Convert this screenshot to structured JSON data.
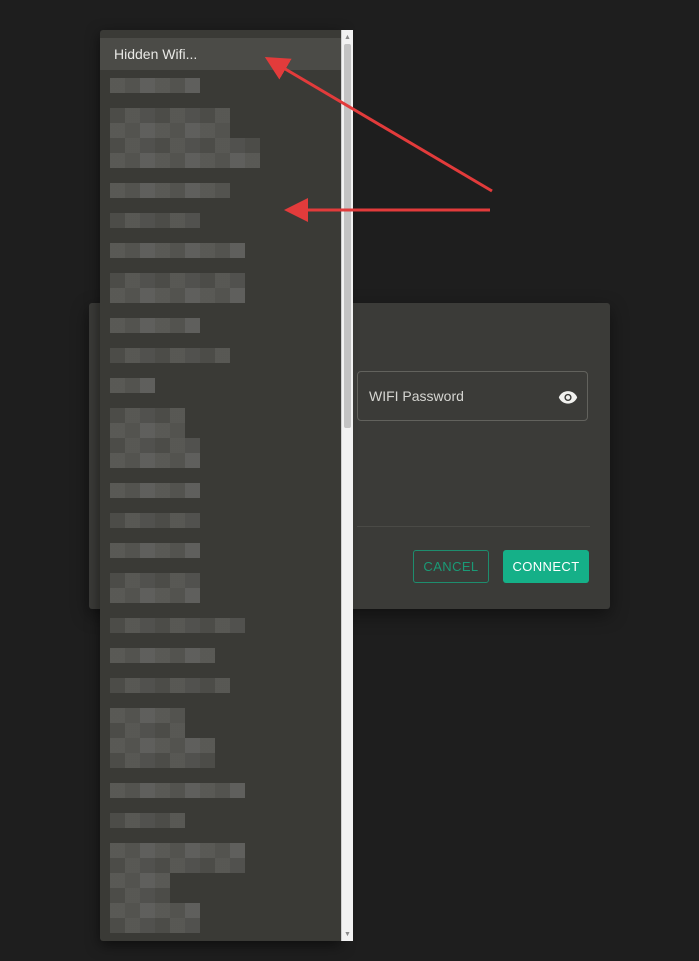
{
  "dialog": {
    "password_label": "WIFI Password",
    "eye_icon": "eye-icon",
    "cancel_label": "CANCEL",
    "connect_label": "CONNECT",
    "accent_color": "#15b088"
  },
  "dropdown": {
    "first_item_label": "Hidden Wifi...",
    "scroll_up_glyph": "▲",
    "scroll_down_glyph": "▼"
  },
  "annotations": {
    "arrow_color": "#e23b3b"
  }
}
